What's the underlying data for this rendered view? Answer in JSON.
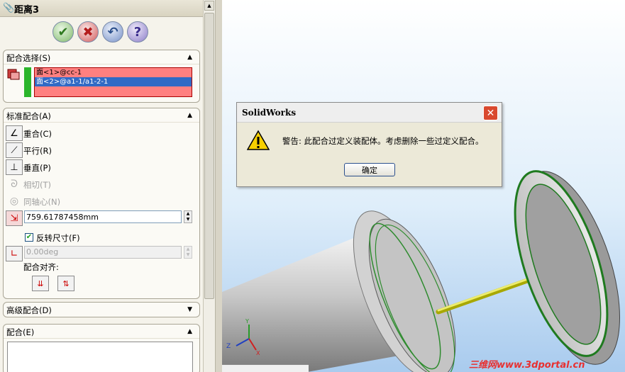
{
  "property_manager": {
    "title": "距离3",
    "actions": {
      "ok": "✔",
      "cancel": "✖",
      "undo": "↶",
      "help": "?"
    },
    "mate_selections": {
      "title": "配合选择(S)",
      "items": [
        "面<1>@cc-1",
        "面<2>@a1-1/a1-2-1"
      ]
    },
    "standard_mates": {
      "title": "标准配合(A)",
      "coincident": "重合(C)",
      "parallel": "平行(R)",
      "perpendicular": "垂直(P)",
      "tangent": "相切(T)",
      "concentric": "同轴心(N)",
      "distance_value": "759.61787458mm",
      "flip_dimension": "反转尺寸(F)",
      "angle_value": "0.00deg",
      "alignment_label": "配合对齐:"
    },
    "advanced_mates": {
      "title": "高级配合(D)"
    },
    "mates": {
      "title": "配合(E)"
    }
  },
  "dialog": {
    "title": "SolidWorks",
    "message": "警告: 此配合过定义装配体。考虑删除一些过定义配合。",
    "ok_label": "确定",
    "close_glyph": "✕"
  },
  "viewport": {
    "watermark": "三维网www.3dportal.cn",
    "triad": {
      "y": "Y",
      "z": "Z",
      "x": "X"
    }
  },
  "icons": {
    "title": "paperclip-icon",
    "warning": "warning-triangle-icon",
    "coincident": "coincident-icon",
    "parallel": "parallel-icon",
    "perpendicular": "perpendicular-icon",
    "tangent": "tangent-icon",
    "concentric": "concentric-icon",
    "distance": "distance-icon",
    "angle": "angle-icon"
  },
  "colors": {
    "accent": "#316ac5",
    "selection_list": "#ff8080",
    "arrow": "#e02020",
    "highlight_edge": "#2e8b2e"
  }
}
